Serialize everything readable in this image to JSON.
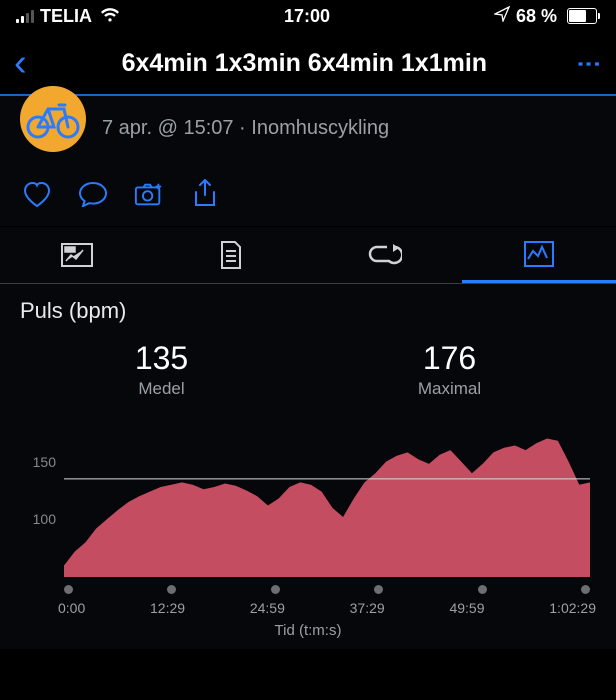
{
  "status": {
    "carrier": "TELIA",
    "time": "17:00",
    "battery_pct": "68 %",
    "battery_fill": 68
  },
  "nav": {
    "title": "6x4min 1x3min 6x4min 1x1min"
  },
  "meta": {
    "line": "7 apr. @ 15:07 · Inomhuscykling"
  },
  "summary": {
    "title": "Puls (bpm)",
    "avg_val": "135",
    "avg_lab": "Medel",
    "max_val": "176",
    "max_lab": "Maximal"
  },
  "chart_data": {
    "type": "area",
    "title": "Puls (bpm)",
    "xlabel": "Tid (t:m:s)",
    "ylabel": "bpm",
    "ylim": [
      50,
      180
    ],
    "y_ticks": [
      100,
      150
    ],
    "x_ticks": [
      "0:00",
      "12:29",
      "24:59",
      "37:29",
      "49:59",
      "1:02:29"
    ],
    "avg_line": 135,
    "series": [
      {
        "name": "Puls",
        "values": [
          60,
          72,
          80,
          92,
          100,
          108,
          115,
          120,
          124,
          128,
          130,
          132,
          130,
          126,
          128,
          131,
          129,
          125,
          120,
          112,
          118,
          128,
          132,
          130,
          124,
          110,
          102,
          118,
          132,
          140,
          150,
          155,
          158,
          152,
          148,
          156,
          160,
          150,
          140,
          148,
          158,
          162,
          164,
          160,
          166,
          170,
          168,
          150,
          130,
          132
        ]
      }
    ]
  },
  "xaxis_title": "Tid (t:m:s)"
}
